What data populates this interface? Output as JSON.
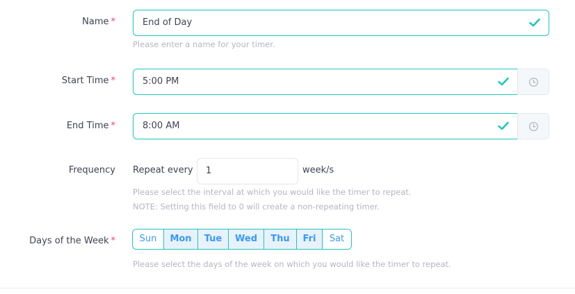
{
  "form": {
    "name": {
      "label": "Name",
      "required_mark": "*",
      "value": "End of Day",
      "help": "Please enter a name for your timer."
    },
    "start_time": {
      "label": "Start Time",
      "required_mark": "*",
      "value": "5:00 PM"
    },
    "end_time": {
      "label": "End Time",
      "required_mark": "*",
      "value": "8:00 AM"
    },
    "frequency": {
      "label": "Frequency",
      "prefix": "Repeat every",
      "value": "1",
      "suffix": "week/s",
      "help": "Please select the interval at which you would like the timer to repeat.",
      "note": "NOTE: Setting this field to 0 will create a non-repeating timer."
    },
    "days_of_week": {
      "label": "Days of the Week",
      "required_mark": "*",
      "days": [
        {
          "label": "Sun",
          "selected": false
        },
        {
          "label": "Mon",
          "selected": true
        },
        {
          "label": "Tue",
          "selected": true
        },
        {
          "label": "Wed",
          "selected": true
        },
        {
          "label": "Thu",
          "selected": true
        },
        {
          "label": "Fri",
          "selected": true
        },
        {
          "label": "Sat",
          "selected": false
        }
      ],
      "help": "Please select the days of the week on which you would like the timer to repeat."
    }
  },
  "colors": {
    "valid": "#1bc5bd",
    "required": "#f1416c",
    "day_text": "#3699ff",
    "day_selected_bg": "#e8f2fb",
    "help_text": "#b5b5c3"
  },
  "icons": {
    "valid": "check-icon",
    "time_picker": "clock-icon"
  }
}
